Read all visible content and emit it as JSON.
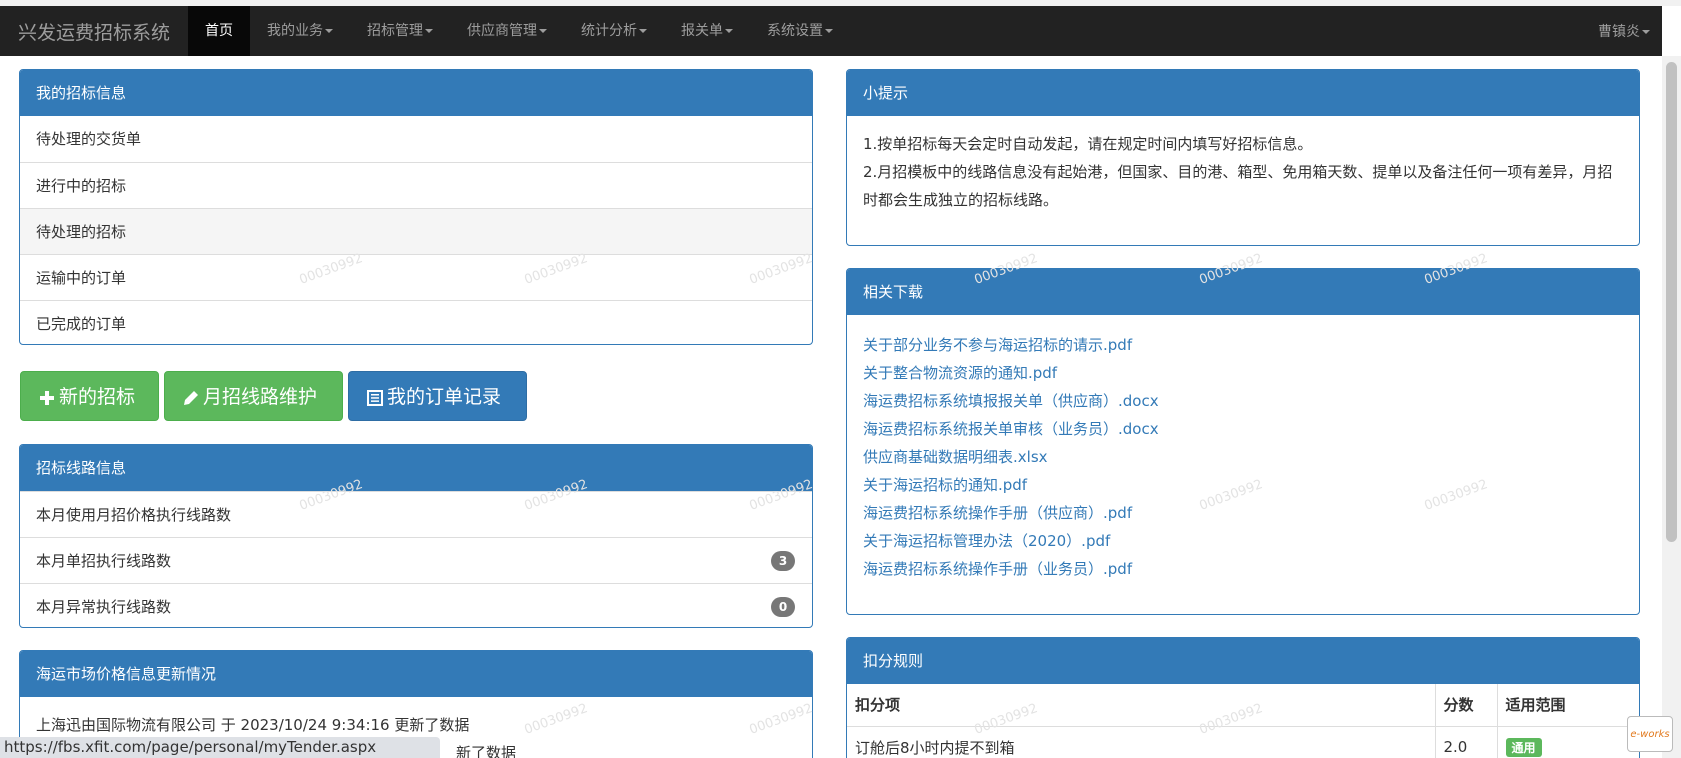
{
  "nav": {
    "brand": "兴发运费招标系统",
    "items": [
      {
        "label": "首页",
        "active": true,
        "dropdown": false
      },
      {
        "label": "我的业务",
        "active": false,
        "dropdown": true
      },
      {
        "label": "招标管理",
        "active": false,
        "dropdown": true
      },
      {
        "label": "供应商管理",
        "active": false,
        "dropdown": true
      },
      {
        "label": "统计分析",
        "active": false,
        "dropdown": true
      },
      {
        "label": "报关单",
        "active": false,
        "dropdown": true
      },
      {
        "label": "系统设置",
        "active": false,
        "dropdown": true
      }
    ],
    "user": "曹镇炎"
  },
  "my_tender": {
    "title": "我的招标信息",
    "items": [
      "待处理的交货单",
      "进行中的招标",
      "待处理的招标",
      "运输中的订单",
      "已完成的订单"
    ]
  },
  "actions": {
    "new_tender": "新的招标",
    "monthly_route": "月招线路维护",
    "my_orders": "我的订单记录"
  },
  "route_info": {
    "title": "招标线路信息",
    "items": [
      {
        "label": "本月使用月招价格执行线路数",
        "badge": ""
      },
      {
        "label": "本月单招执行线路数",
        "badge": "3"
      },
      {
        "label": "本月异常执行线路数",
        "badge": "0"
      }
    ]
  },
  "market": {
    "title": "海运市场价格信息更新情况",
    "line1": "上海迅由国际物流有限公司 于 2023/10/24 9:34:16 更新了数据",
    "line2_tail": "新了数据"
  },
  "tips": {
    "title": "小提示",
    "line1": "1.按单招标每天会定时自动发起，请在规定时间内填写好招标信息。",
    "line2": "2.月招模板中的线路信息没有起始港，但国家、目的港、箱型、免用箱天数、提单以及备注任何一项有差异，月招时都会生成独立的招标线路。"
  },
  "downloads": {
    "title": "相关下载",
    "files": [
      "关于部分业务不参与海运招标的请示.pdf",
      "关于整合物流资源的通知.pdf",
      "海运费招标系统填报报关单（供应商）.docx",
      "海运费招标系统报关单审核（业务员）.docx",
      "供应商基础数据明细表.xlsx",
      "关于海运招标的通知.pdf",
      "海运费招标系统操作手册（供应商）.pdf",
      "关于海运招标管理办法（2020）.pdf",
      "海运费招标系统操作手册（业务员）.pdf"
    ]
  },
  "deduction": {
    "title": "扣分规则",
    "headers": [
      "扣分项",
      "分数",
      "适用范围"
    ],
    "rows": [
      {
        "item": "订舱后8小时内提不到箱",
        "score": "2.0",
        "scope": "通用"
      }
    ]
  },
  "statusbar": {
    "url": "https://fbs.xfit.com/page/personal/myTender.aspx"
  },
  "watermark": "00030992",
  "corner_logo": "e-works",
  "colors": {
    "primary": "#337ab7",
    "success": "#5cb85c",
    "navbar": "#222222"
  }
}
